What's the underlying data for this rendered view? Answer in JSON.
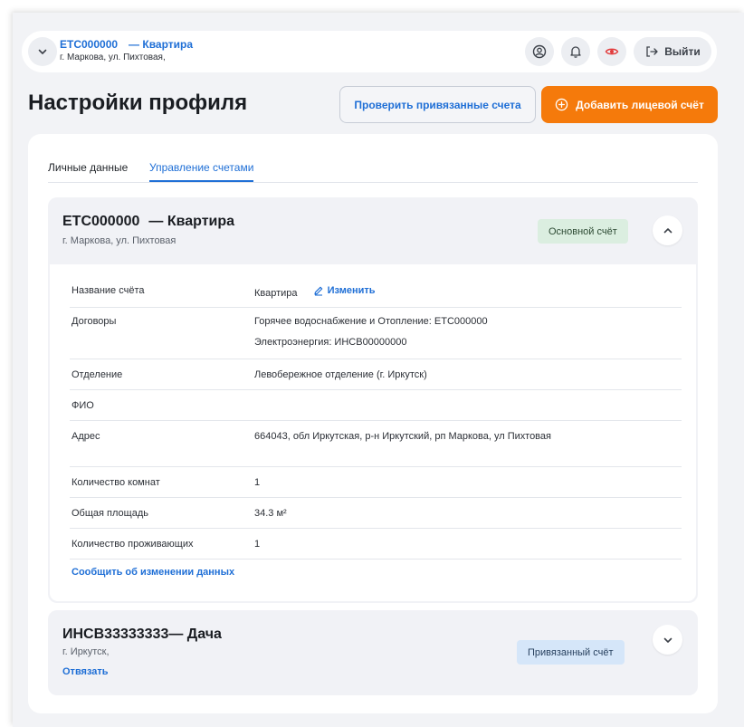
{
  "header": {
    "account_number": "ETC000000",
    "account_type": "— Квартира",
    "address": "г. Маркова, ул. Пихтовая,",
    "logout_label": "Выйти"
  },
  "page": {
    "title": "Настройки профиля",
    "check_button": "Проверить привязанные счета",
    "add_button": "Добавить лицевой счёт"
  },
  "tabs": [
    {
      "label": "Личные данные",
      "active": false
    },
    {
      "label": "Управление счетами",
      "active": true
    }
  ],
  "accounts": [
    {
      "number": "ETC000000",
      "name": "— Квартира",
      "address": "г. Маркова, ул. Пихтовая",
      "badge": "Основной счёт",
      "details": {
        "rows": [
          {
            "key": "Название счёта",
            "value": "Квартира",
            "action": "Изменить"
          },
          {
            "key": "Договоры",
            "value": "Горячее водоснабжение и Отопление: ETC000000",
            "value2": "Электроэнергия: ИНСВ00000000"
          },
          {
            "key": "Отделение",
            "value": "Левобережное отделение (г. Иркутск)"
          },
          {
            "key": "ФИО",
            "value": ""
          },
          {
            "key": "Адрес",
            "value": "664043, обл Иркутская, р-н Иркутский, рп Маркова, ул Пихтовая"
          },
          {
            "key": "Количество комнат",
            "value": "1"
          },
          {
            "key": "Общая площадь",
            "value": "34.3 м²"
          },
          {
            "key": "Количество проживающих",
            "value": "1"
          }
        ],
        "report_link": "Сообщить об изменении данных"
      }
    },
    {
      "number": "ИНСВ33333333",
      "name": "— Дача",
      "address": "г. Иркутск,",
      "badge": "Привязанный счёт",
      "unlink": "Отвязать"
    }
  ],
  "colors": {
    "accent": "#1f6fd6",
    "orange": "#f57a0b",
    "main_badge": "#dbeee0",
    "linked_badge": "#d5e6f9",
    "eye_icon": "#e23b3b"
  },
  "icons": [
    "chevron-down-icon",
    "user-circle-icon",
    "bell-icon",
    "eye-icon",
    "logout-icon",
    "plus-circle-icon",
    "pencil-icon",
    "chevron-up-icon"
  ]
}
